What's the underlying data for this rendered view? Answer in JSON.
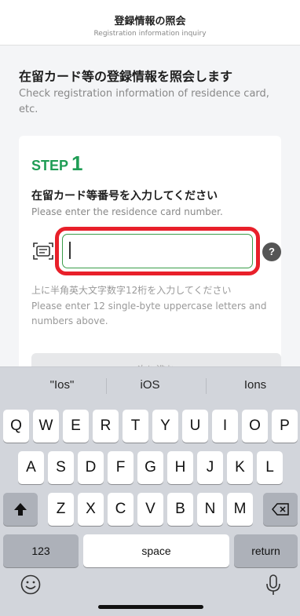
{
  "header": {
    "title": "登録情報の照会",
    "subtitle": "Registration information inquiry"
  },
  "intro": {
    "heading_ja": "在留カード等の登録情報を照会します",
    "heading_en": "Check registration information of residence card, etc."
  },
  "step": {
    "word": "STEP",
    "number": "1",
    "prompt_ja": "在留カード等番号を入力してください",
    "prompt_en": "Please enter the residence card number.",
    "input_value": "",
    "help_label": "?",
    "hint_ja": "上に半角英大文字数字12桁を入力してください",
    "hint_en": "Please enter 12 single-byte uppercase letters and numbers above.",
    "next_label": "次に進む"
  },
  "keyboard": {
    "suggestions": [
      "\"Ios\"",
      "iOS",
      "Ions"
    ],
    "row1": [
      "Q",
      "W",
      "E",
      "R",
      "T",
      "Y",
      "U",
      "I",
      "O",
      "P"
    ],
    "row2": [
      "A",
      "S",
      "D",
      "F",
      "G",
      "H",
      "J",
      "K",
      "L"
    ],
    "row3": [
      "Z",
      "X",
      "C",
      "V",
      "B",
      "N",
      "M"
    ],
    "numbers_label": "123",
    "space_label": "space",
    "return_label": "return"
  },
  "colors": {
    "accent_green": "#1f9d55",
    "highlight_red": "#e8202a"
  }
}
